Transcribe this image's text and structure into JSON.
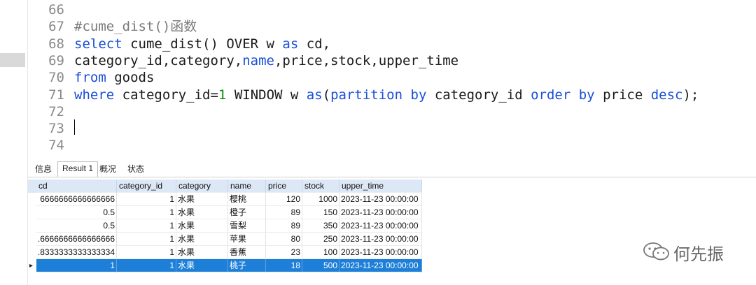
{
  "editor": {
    "lines": [
      {
        "n": "66",
        "code": []
      },
      {
        "n": "67",
        "code": [
          {
            "t": "#cume_dist()函数",
            "c": "cm"
          }
        ]
      },
      {
        "n": "68",
        "code": [
          {
            "t": "select",
            "c": "kw"
          },
          {
            "t": " cume_dist() OVER w ",
            "c": ""
          },
          {
            "t": "as",
            "c": "kw"
          },
          {
            "t": " cd,",
            "c": ""
          }
        ]
      },
      {
        "n": "69",
        "code": [
          {
            "t": "category_id,category,",
            "c": ""
          },
          {
            "t": "name",
            "c": "kw"
          },
          {
            "t": ",price,stock,upper_time",
            "c": ""
          }
        ]
      },
      {
        "n": "70",
        "code": [
          {
            "t": "from",
            "c": "kw"
          },
          {
            "t": " goods",
            "c": ""
          }
        ]
      },
      {
        "n": "71",
        "code": [
          {
            "t": "where",
            "c": "kw"
          },
          {
            "t": " category_id=",
            "c": ""
          },
          {
            "t": "1",
            "c": "num"
          },
          {
            "t": " WINDOW w ",
            "c": ""
          },
          {
            "t": "as",
            "c": "kw"
          },
          {
            "t": "(",
            "c": ""
          },
          {
            "t": "partition by",
            "c": "kw"
          },
          {
            "t": " category_id ",
            "c": ""
          },
          {
            "t": "order by",
            "c": "kw"
          },
          {
            "t": " price ",
            "c": ""
          },
          {
            "t": "desc",
            "c": "kw"
          },
          {
            "t": ");",
            "c": ""
          }
        ]
      },
      {
        "n": "72",
        "code": []
      },
      {
        "n": "73",
        "code": []
      },
      {
        "n": "74",
        "code": []
      }
    ]
  },
  "tabs": [
    {
      "label": "信息",
      "active": false
    },
    {
      "label": "Result 1",
      "active": true
    },
    {
      "label": "概况",
      "active": false
    },
    {
      "label": "状态",
      "active": false
    }
  ],
  "grid": {
    "columns": [
      "cd",
      "category_id",
      "category",
      "name",
      "price",
      "stock",
      "upper_time"
    ],
    "rows": [
      [
        "6666666666666666",
        "1",
        "水果",
        "樱桃",
        "120",
        "1000",
        "2023-11-23 00:00:00"
      ],
      [
        "0.5",
        "1",
        "水果",
        "橙子",
        "89",
        "150",
        "2023-11-23 00:00:00"
      ],
      [
        "0.5",
        "1",
        "水果",
        "雪梨",
        "89",
        "350",
        "2023-11-23 00:00:00"
      ],
      [
        ".6666666666666666",
        "1",
        "水果",
        "苹果",
        "80",
        "250",
        "2023-11-23 00:00:00"
      ],
      [
        ".8333333333333334",
        "1",
        "水果",
        "香蕉",
        "23",
        "100",
        "2023-11-23 00:00:00"
      ],
      [
        "1",
        "1",
        "水果",
        "桃子",
        "18",
        "500",
        "2023-11-23 00:00:00"
      ]
    ],
    "selected_row": 5,
    "row_marker": "▸"
  },
  "watermark": {
    "text": "何先振",
    "icon": "wechat-icon"
  }
}
